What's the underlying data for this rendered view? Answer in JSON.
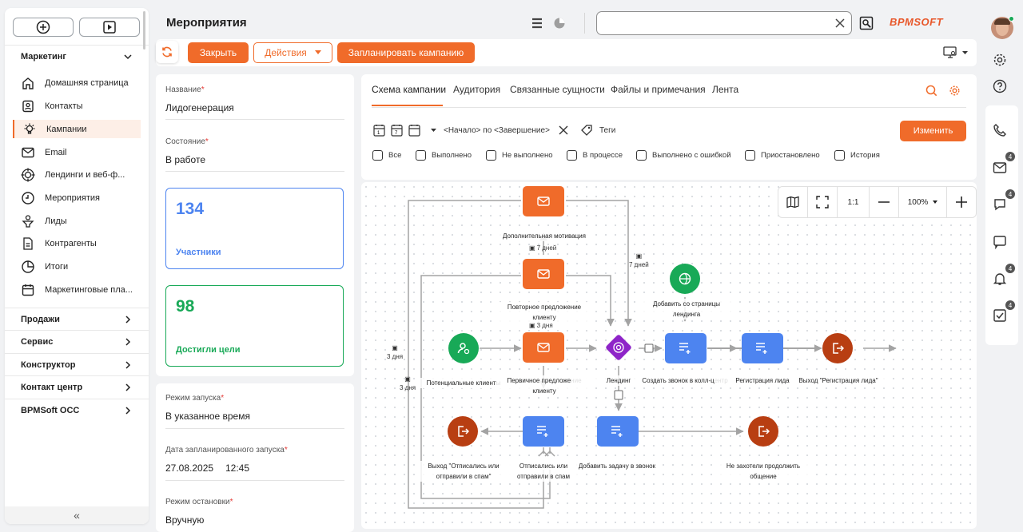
{
  "page_title": "Мероприятия",
  "brand": "BPMSOFT",
  "search": {
    "placeholder": ""
  },
  "actions": {
    "close": "Закрыть",
    "actions": "Действия",
    "schedule": "Запланировать кампанию"
  },
  "sidebar": {
    "group_marketing": "Маркетинг",
    "items": [
      {
        "label": "Домашняя страница",
        "icon": "home-icon"
      },
      {
        "label": "Контакты",
        "icon": "contact-icon"
      },
      {
        "label": "Кампании",
        "icon": "bulb-icon"
      },
      {
        "label": "Email",
        "icon": "mail-icon"
      },
      {
        "label": "Лендинги и веб-ф...",
        "icon": "target-icon"
      },
      {
        "label": "Мероприятия",
        "icon": "clock-icon"
      },
      {
        "label": "Лиды",
        "icon": "funnel-icon"
      },
      {
        "label": "Контрагенты",
        "icon": "document-icon"
      },
      {
        "label": "Итоги",
        "icon": "pie-icon"
      },
      {
        "label": "Маркетинговые пла...",
        "icon": "calendar-icon"
      }
    ],
    "groups": [
      "Продажи",
      "Сервис",
      "Конструктор",
      "Контакт центр",
      "BPMSoft OCC"
    ],
    "collapse": "«"
  },
  "form": {
    "name_label": "Название",
    "name_value": "Лидогенерация",
    "state_label": "Состояние",
    "state_value": "В работе",
    "participants_num": "134",
    "participants_label": "Участники",
    "goals_num": "98",
    "goals_label": "Достигли цели",
    "launch_mode_label": "Режим запуска",
    "launch_mode_value": "В указанное время",
    "planned_label": "Дата запланированного запуска",
    "planned_date": "27.08.2025",
    "planned_time": "12:45",
    "stop_label": "Режим остановки",
    "stop_value": "Вручную"
  },
  "tabs": [
    "Схема кампании",
    "Аудитория",
    "Связанные сущности",
    "Файлы и примечания",
    "Лента"
  ],
  "filter": {
    "range": "<Начало> по <Завершение>",
    "tags": "Теги",
    "change": "Изменить"
  },
  "checkboxes": [
    "Все",
    "Выполнено",
    "Не выполнено",
    "В процессе",
    "Выполнено с ошибкой",
    "Приостановлено",
    "История"
  ],
  "zoom": {
    "ratio": "1:1",
    "level": "100%"
  },
  "flow": {
    "n_motivation": "Дополнительная мотивация",
    "n_repeat": "Повторное предложение клиенту",
    "n_potential": "Потенциальные клиенты",
    "n_primary": "Первичное предложение клиенту",
    "n_landing": "Лендинг",
    "n_add_page": "Добавить со страницы лендинга",
    "n_call": "Создать звонок в колл-центр",
    "n_reg": "Регистрация лида",
    "n_exit_reg": "Выход \"Регистрация лида\"",
    "n_exit_unsub": "Выход \"Отписались или отправили в спам\"",
    "n_unsub": "Отписались или отправили в спам",
    "n_task": "Добавить задачу в звонок",
    "n_declined": "Не захотели продолжить общение",
    "d_7a": "7 дней",
    "d_3a": "3 дня",
    "d_7b": "7 дней",
    "d_3b": "3 дня",
    "d_3c": "3 дня"
  },
  "rail": {
    "badges": [
      "4",
      "4",
      "4",
      "4"
    ]
  },
  "colors": {
    "accent": "#f06b2a",
    "blue": "#4d84f0",
    "green": "#18a957",
    "exit": "#b83e12",
    "purple": "#8e24c8"
  }
}
